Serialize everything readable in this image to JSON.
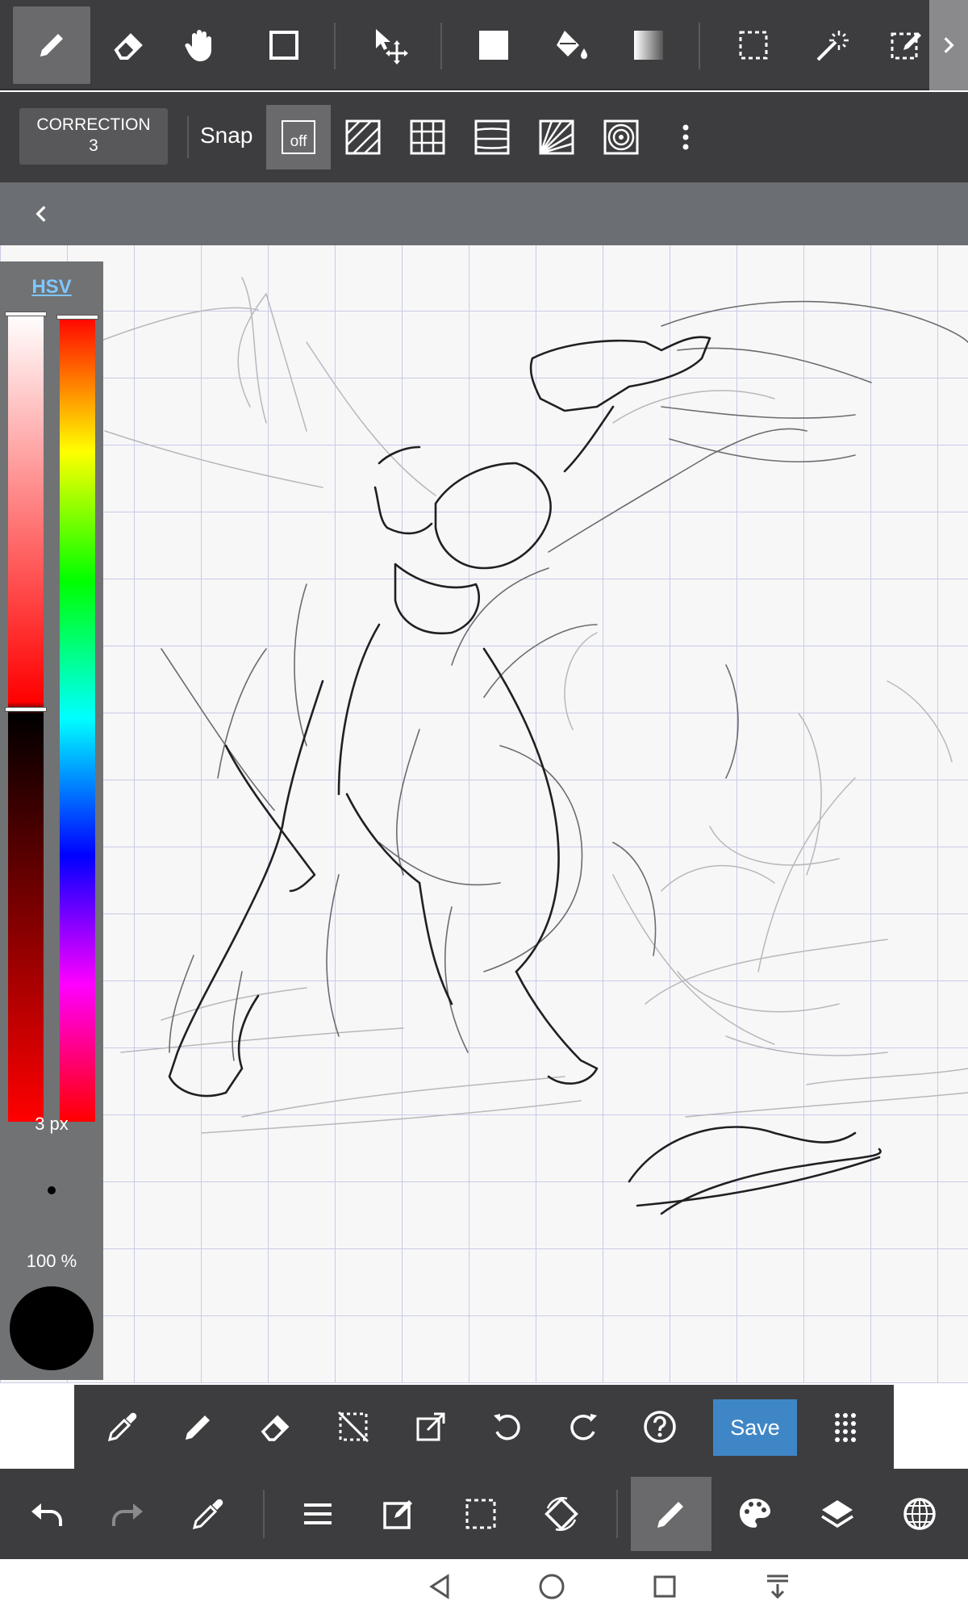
{
  "top_toolbar": {
    "tools": [
      {
        "name": "pen",
        "icon": "pen-icon",
        "active": true
      },
      {
        "name": "eraser",
        "icon": "eraser-icon"
      },
      {
        "name": "hand",
        "icon": "hand-icon"
      },
      {
        "name": "shape",
        "icon": "rectangle-icon"
      },
      {
        "name": "move",
        "icon": "move-select-icon"
      },
      {
        "name": "fill-rect",
        "icon": "filled-rectangle-icon"
      },
      {
        "name": "bucket",
        "icon": "paint-bucket-icon"
      },
      {
        "name": "gradient",
        "icon": "gradient-icon"
      },
      {
        "name": "select",
        "icon": "selection-icon"
      },
      {
        "name": "magic-wand",
        "icon": "magic-wand-icon"
      },
      {
        "name": "select-pen",
        "icon": "selection-pen-icon"
      }
    ]
  },
  "second_toolbar": {
    "correction_label": "CORRECTION",
    "correction_value": "3",
    "snap_label": "Snap",
    "snap_off_label": "off"
  },
  "color_panel": {
    "mode_tab": "HSV",
    "brush_size": "3 px",
    "opacity": "100 %",
    "current_color": "#000000",
    "sv_level": 0.48,
    "hue_level": 0.0
  },
  "quick_bar": {
    "save_label": "Save"
  },
  "theme": {
    "toolbar_bg": "#3d3d3f",
    "active_bg": "#6a6a6c",
    "accent": "#3f86c6",
    "hsv_link": "#7fc6ff"
  }
}
